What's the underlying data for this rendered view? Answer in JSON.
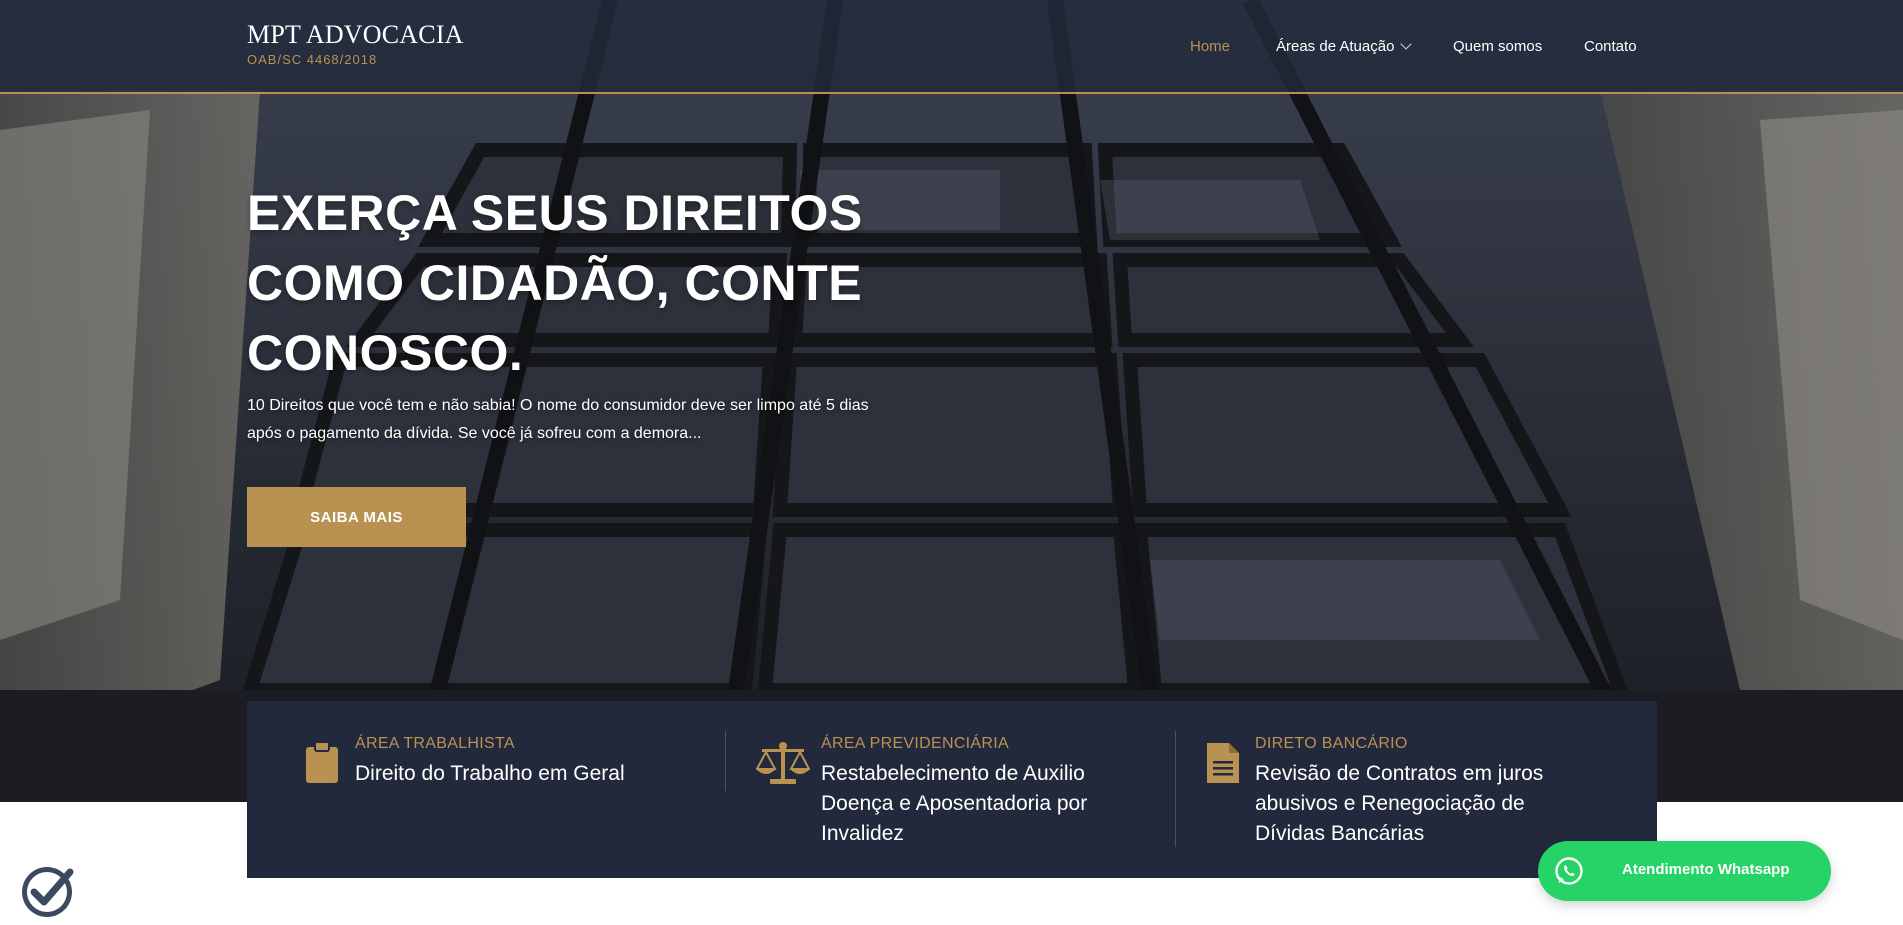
{
  "brand": {
    "name": "MPT ADVOCACIA",
    "subtitle": "OAB/SC 4468/2018"
  },
  "nav": {
    "items": [
      {
        "label": "Home",
        "active": true
      },
      {
        "label": "Áreas de Atuação",
        "has_dropdown": true
      },
      {
        "label": "Quem somos"
      },
      {
        "label": "Contato"
      }
    ]
  },
  "hero": {
    "title": "EXERÇA SEUS DIREITOS COMO CIDADÃO, CONTE CONOSCO.",
    "description": "10 Direitos que você tem e não sabia! O nome do consumidor deve ser limpo até 5 dias após o pagamento da dívida. Se você já sofreu com a demora...",
    "cta_label": "SAIBA MAIS"
  },
  "features": [
    {
      "icon": "clipboard-icon",
      "category": "ÁREA TRABALHISTA",
      "title": "Direito do Trabalho em Geral"
    },
    {
      "icon": "balance-scale-icon",
      "category": "ÁREA PREVIDENCIÁRIA",
      "title": "Restabelecimento de Auxilio Doença e Aposentadoria por Invalidez"
    },
    {
      "icon": "document-icon",
      "category": "DIRETO BANCÁRIO",
      "title": "Revisão de Contratos em juros abusivos e Renegociação de Dívidas Bancárias"
    }
  ],
  "whatsapp": {
    "label": "Atendimento Whatsapp",
    "icon": "whatsapp-icon"
  },
  "colors": {
    "accent": "#b99252",
    "navy": "#22293c",
    "whatsapp": "#25d366"
  }
}
